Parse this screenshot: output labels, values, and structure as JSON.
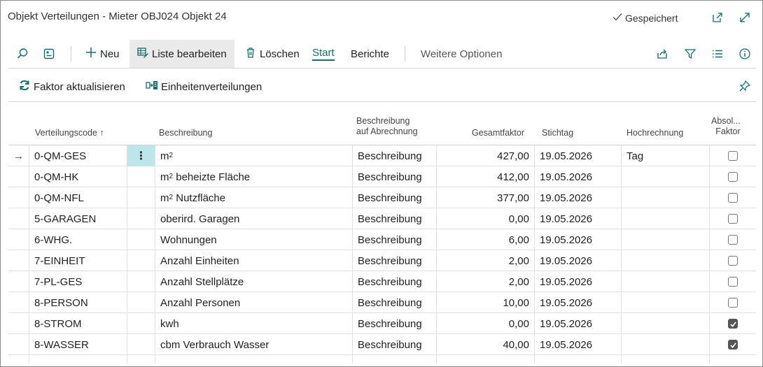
{
  "window": {
    "title": "Objekt Verteilungen - Mieter OBJ024 Objekt 24",
    "saved_label": "Gespeichert"
  },
  "actions": {
    "new_label": "Neu",
    "edit_list_label": "Liste bearbeiten",
    "delete_label": "Löschen",
    "start_label": "Start",
    "reports_label": "Berichte",
    "more_options_label": "Weitere Optionen"
  },
  "secondary": {
    "update_factor_label": "Faktor aktualisieren",
    "unit_distribution_label": "Einheitenverteilungen"
  },
  "columns": {
    "code": "Verteilungscode ↑",
    "description": "Beschreibung",
    "billing_desc_line1": "Beschreibung",
    "billing_desc_line2": "auf Abrechnung",
    "total_factor": "Gesamtfaktor",
    "cutoff_date": "Stichtag",
    "extrapolation": "Hochrechnung",
    "abs_factor_line1": "Absol...",
    "abs_factor_line2": "Faktor"
  },
  "rows": [
    {
      "code": "0-QM-GES",
      "desc": "m",
      "desc_sup": "2",
      "desc_rest": "",
      "billing": "Beschreibung",
      "factor": "427,00",
      "date": "19.05.2026",
      "extrap": "Tag",
      "abs": false,
      "selected": true
    },
    {
      "code": "0-QM-HK",
      "desc": "m",
      "desc_sup": "2",
      "desc_rest": " beheizte Fläche",
      "billing": "Beschreibung",
      "factor": "412,00",
      "date": "19.05.2026",
      "extrap": "",
      "abs": false
    },
    {
      "code": "0-QM-NFL",
      "desc": "m",
      "desc_sup": "2",
      "desc_rest": " Nutzfläche",
      "billing": "Beschreibung",
      "factor": "377,00",
      "date": "19.05.2026",
      "extrap": "",
      "abs": false
    },
    {
      "code": "5-GARAGEN",
      "desc": "oberird. Garagen",
      "desc_sup": "",
      "desc_rest": "",
      "billing": "Beschreibung",
      "factor": "0,00",
      "date": "19.05.2026",
      "extrap": "",
      "abs": false
    },
    {
      "code": "6-WHG.",
      "desc": "Wohnungen",
      "desc_sup": "",
      "desc_rest": "",
      "billing": "Beschreibung",
      "factor": "6,00",
      "date": "19.05.2026",
      "extrap": "",
      "abs": false
    },
    {
      "code": "7-EINHEIT",
      "desc": "Anzahl Einheiten",
      "desc_sup": "",
      "desc_rest": "",
      "billing": "Beschreibung",
      "factor": "2,00",
      "date": "19.05.2026",
      "extrap": "",
      "abs": false
    },
    {
      "code": "7-PL-GES",
      "desc": "Anzahl Stellplätze",
      "desc_sup": "",
      "desc_rest": "",
      "billing": "Beschreibung",
      "factor": "2,00",
      "date": "19.05.2026",
      "extrap": "",
      "abs": false
    },
    {
      "code": "8-PERSON",
      "desc": "Anzahl Personen",
      "desc_sup": "",
      "desc_rest": "",
      "billing": "Beschreibung",
      "factor": "10,00",
      "date": "19.05.2026",
      "extrap": "",
      "abs": false
    },
    {
      "code": "8-STROM",
      "desc": "kwh",
      "desc_sup": "",
      "desc_rest": "",
      "billing": "Beschreibung",
      "factor": "0,00",
      "date": "19.05.2026",
      "extrap": "",
      "abs": true
    },
    {
      "code": "8-WASSER",
      "desc": "cbm Verbrauch Wasser",
      "desc_sup": "",
      "desc_rest": "",
      "billing": "Beschreibung",
      "factor": "40,00",
      "date": "19.05.2026",
      "extrap": "",
      "abs": true
    }
  ],
  "colors": {
    "accent": "#0f6e6e",
    "selected_cell": "#bde6ea",
    "pressed_button": "#eaeaea"
  },
  "icons": [
    "checkmark-icon",
    "open-new-window-icon",
    "expand-icon",
    "search-icon",
    "card-view-icon",
    "plus-icon",
    "edit-list-icon",
    "trash-icon",
    "share-icon",
    "filter-icon",
    "list-icon",
    "info-icon",
    "refresh-icon",
    "unit-distribution-icon",
    "pin-icon",
    "row-arrow-icon",
    "more-dots-icon"
  ]
}
